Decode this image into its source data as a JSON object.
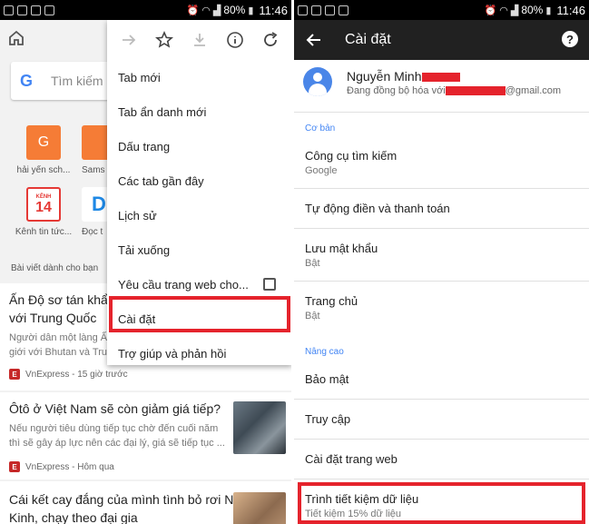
{
  "status_bar": {
    "battery": "80%",
    "time": "11:46"
  },
  "left": {
    "search_placeholder": "Tìm kiếm ho",
    "google_letter": "G",
    "tiles": [
      {
        "label": "hải yến sch...",
        "letter": "G",
        "color": "#f57c36"
      },
      {
        "label": "Sams",
        "letter": "",
        "color": "#f57c36"
      },
      {
        "label": "Kênh tin tức...",
        "letter": "14",
        "color": "#e53935",
        "top_text": "KÊNH"
      },
      {
        "label": "Đọc t",
        "letter": "D",
        "color": "#1e88e5"
      }
    ],
    "section_header": "Bài viết dành cho bạn",
    "cards": [
      {
        "title_line1": "Ấn Độ sơ tán khẩn c",
        "title_line2": "với Trung Quốc",
        "desc_line1": "Người dân một làng Ấ",
        "desc_line2": "giới với Bhutan và Tru",
        "source": "VnExpress - 15 giờ trước"
      },
      {
        "title_line1": "Ôtô ở Việt Nam sẽ còn giảm giá tiếp?",
        "desc_line1": "Nếu người tiêu dùng tiếp tục chờ đến cuối năm",
        "desc_line2": "thì sẽ gây áp lực nên các đại lý, giá sẽ tiếp tục ...",
        "source": "VnExpress - Hôm qua"
      },
      {
        "title_line1": "Cái kết cay đắng của mình tình bỏ rơi Ngô",
        "title_line2": "Kinh, chạy theo đại gia"
      }
    ],
    "menu": {
      "items": [
        "Tab mới",
        "Tab ẩn danh mới",
        "Dấu trang",
        "Các tab gần đây",
        "Lịch sử",
        "Tải xuống",
        "Yêu cầu trang web cho...",
        "Cài đặt",
        "Trợ giúp và phản hồi"
      ]
    }
  },
  "right": {
    "title": "Cài đặt",
    "help_glyph": "?",
    "account": {
      "name": "Nguyễn Minh",
      "sync_prefix": "Đang đồng bộ hóa với",
      "sync_suffix": "@gmail.com"
    },
    "sections": {
      "basic": "Cơ bản",
      "advanced": "Nâng cao"
    },
    "items": {
      "search_engine": {
        "title": "Công cụ tìm kiếm",
        "sub": "Google"
      },
      "autofill": {
        "title": "Tự động điền và thanh toán"
      },
      "passwords": {
        "title": "Lưu mật khẩu",
        "sub": "Bật"
      },
      "homepage": {
        "title": "Trang chủ",
        "sub": "Bật"
      },
      "privacy": {
        "title": "Bảo mật"
      },
      "accessibility": {
        "title": "Truy cập"
      },
      "site_settings": {
        "title": "Cài đặt trang web"
      },
      "data_saver": {
        "title": "Trình tiết kiệm dữ liệu",
        "sub": "Tiết kiệm 15% dữ liệu"
      }
    }
  },
  "colors": {
    "highlight": "#e5232c",
    "accent_blue": "#4285f4",
    "appbar": "#212121"
  }
}
